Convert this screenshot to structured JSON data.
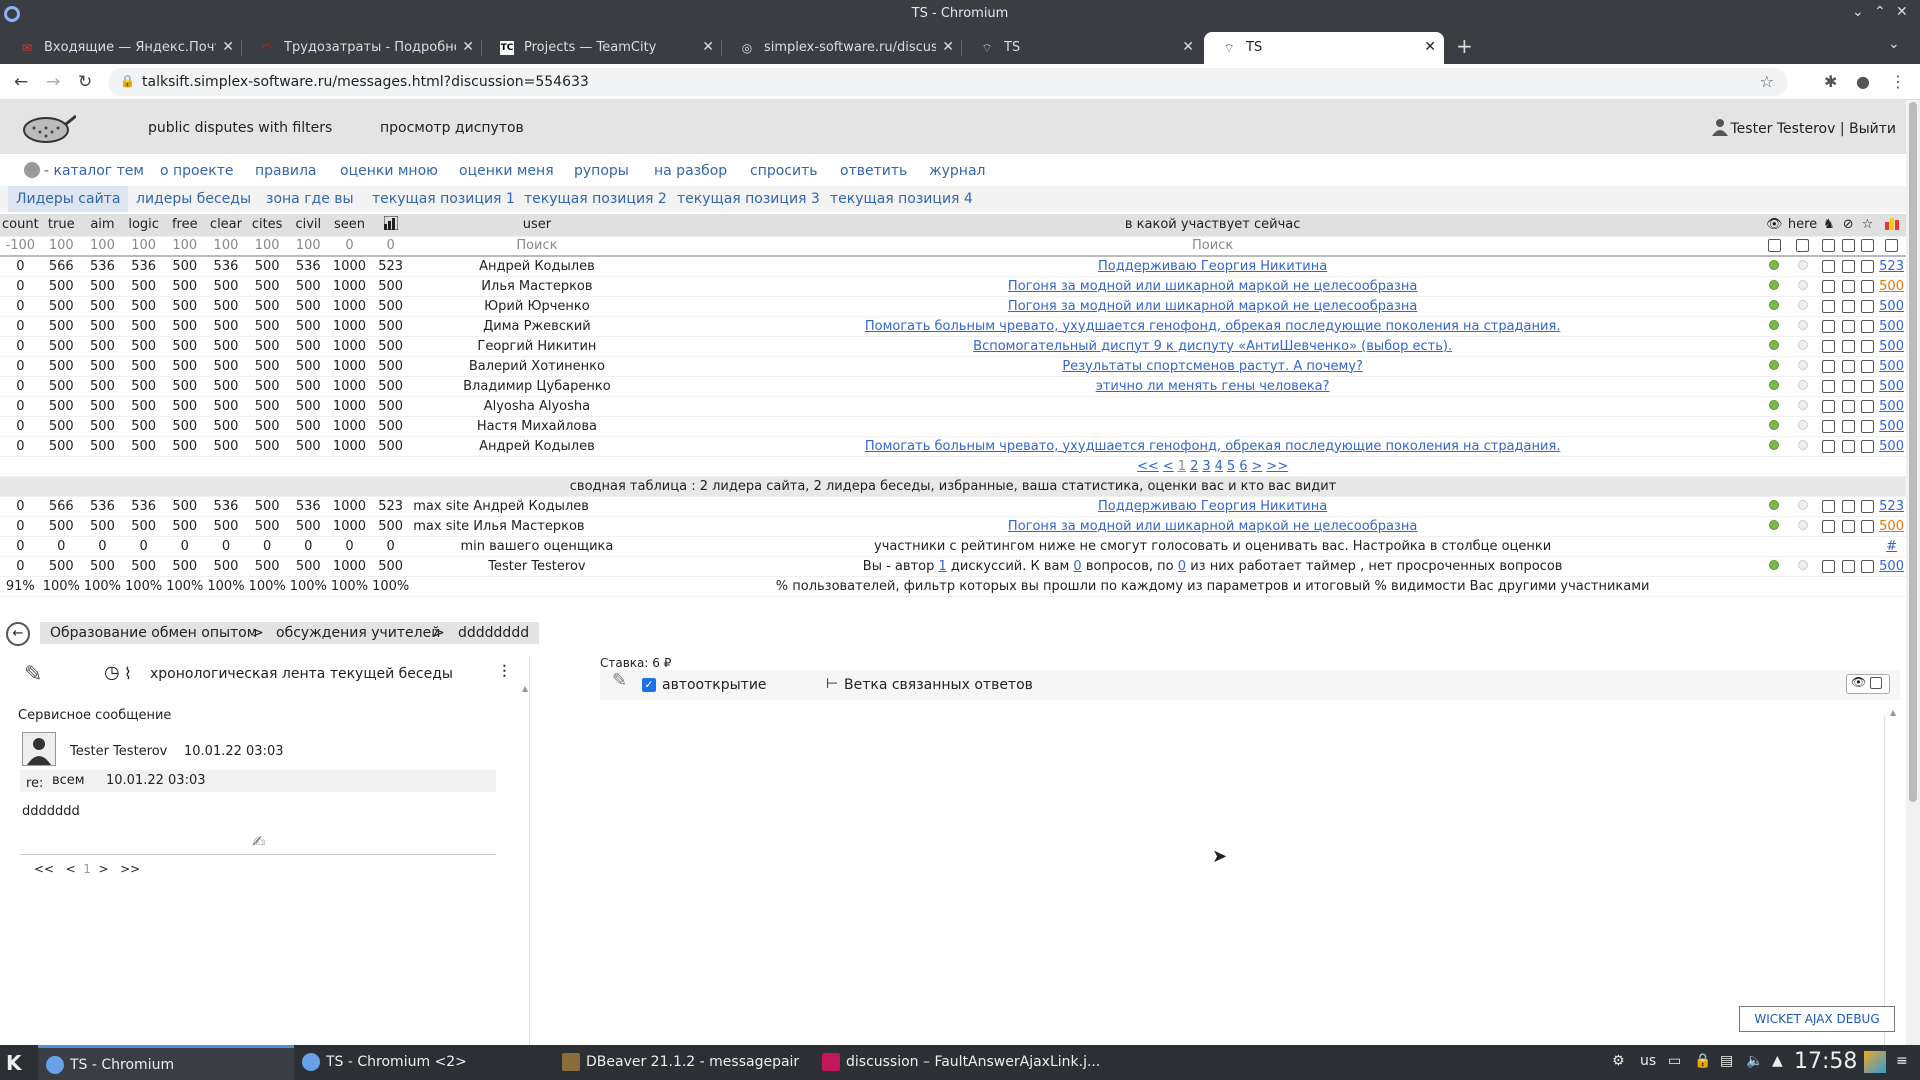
{
  "window": {
    "title": "TS - Chromium"
  },
  "tabs": [
    {
      "label": "Входящие — Яндекс.Почта",
      "icon": "mail-icon"
    },
    {
      "label": "Трудозатраты - Подробност",
      "icon": "redmine-icon"
    },
    {
      "label": "Projects — TeamCity",
      "icon": "teamcity-icon"
    },
    {
      "label": "simplex-software.ru/discussio",
      "icon": "globe-icon"
    },
    {
      "label": "TS",
      "icon": "site-icon"
    },
    {
      "label": "TS",
      "icon": "site-icon"
    }
  ],
  "address": {
    "url": "talksift.simplex-software.ru/messages.html?discussion=554633"
  },
  "site": {
    "title1": "public disputes with filters",
    "title2": "просмотр диспутов",
    "user": "Tester Testerov | Выйти"
  },
  "menu": [
    "- каталог тем",
    "о проекте",
    "правила",
    "оценки мною",
    "оценки меня",
    "рупоры",
    "на разбор",
    "спросить",
    "ответить",
    "журнал"
  ],
  "subtabs": [
    "Лидеры сайта",
    "лидеры беседы",
    "зона где вы",
    "текущая позиция 1",
    "текущая позиция 2",
    "текущая позиция 3",
    "текущая позиция 4"
  ],
  "table": {
    "headers": [
      "count",
      "true",
      "aim",
      "logic",
      "free",
      "clear",
      "cites",
      "civil",
      "seen",
      "",
      "user",
      "в какой участвует сейчас",
      "",
      "here",
      "",
      "",
      "",
      ""
    ],
    "search_placeholder": "Поиск",
    "filter_row": [
      "-100",
      "100",
      "100",
      "100",
      "100",
      "100",
      "100",
      "100",
      "0",
      "0"
    ],
    "rows": [
      {
        "n": [
          "0",
          "566",
          "536",
          "536",
          "500",
          "536",
          "500",
          "536",
          "1000",
          "523"
        ],
        "user": "Андрей Кодылев",
        "topic": "Поддерживаю Георгия Никитина",
        "score": "523",
        "orange": false
      },
      {
        "n": [
          "0",
          "500",
          "500",
          "500",
          "500",
          "500",
          "500",
          "500",
          "1000",
          "500"
        ],
        "user": "Илья Мастерков",
        "topic": "Погоня за модной или шикарной маркой не целесообразна",
        "score": "500",
        "orange": true
      },
      {
        "n": [
          "0",
          "500",
          "500",
          "500",
          "500",
          "500",
          "500",
          "500",
          "1000",
          "500"
        ],
        "user": "Юрий Юрченко",
        "topic": "Погоня за модной или шикарной маркой не целесообразна",
        "score": "500",
        "orange": false
      },
      {
        "n": [
          "0",
          "500",
          "500",
          "500",
          "500",
          "500",
          "500",
          "500",
          "1000",
          "500"
        ],
        "user": "Дима Ржевский",
        "topic": "Помогать больным чревато, ухудшается генофонд, обрекая последующие поколения на страдания.",
        "score": "500",
        "orange": false
      },
      {
        "n": [
          "0",
          "500",
          "500",
          "500",
          "500",
          "500",
          "500",
          "500",
          "1000",
          "500"
        ],
        "user": "Георгий Никитин",
        "topic": "Вспомогательный диспут 9 к диспуту «АнтиШевченко» (выбор есть).",
        "score": "500",
        "orange": false
      },
      {
        "n": [
          "0",
          "500",
          "500",
          "500",
          "500",
          "500",
          "500",
          "500",
          "1000",
          "500"
        ],
        "user": "Валерий Хотиненко",
        "topic": "Результаты спортсменов растут. А почему?",
        "score": "500",
        "orange": false
      },
      {
        "n": [
          "0",
          "500",
          "500",
          "500",
          "500",
          "500",
          "500",
          "500",
          "1000",
          "500"
        ],
        "user": "Владимир Цубаренко",
        "topic": "этично ли менять гены человека?",
        "score": "500",
        "orange": false
      },
      {
        "n": [
          "0",
          "500",
          "500",
          "500",
          "500",
          "500",
          "500",
          "500",
          "1000",
          "500"
        ],
        "user": "Alyosha Alyosha",
        "topic": "",
        "score": "500",
        "orange": false
      },
      {
        "n": [
          "0",
          "500",
          "500",
          "500",
          "500",
          "500",
          "500",
          "500",
          "1000",
          "500"
        ],
        "user": "Настя Михайлова",
        "topic": "",
        "score": "500",
        "orange": false
      },
      {
        "n": [
          "0",
          "500",
          "500",
          "500",
          "500",
          "500",
          "500",
          "500",
          "1000",
          "500"
        ],
        "user": "Андрей Кодылев",
        "topic": "Помогать больным чревато, ухудшается генофонд, обрекая последующие поколения на страдания.",
        "score": "500",
        "orange": false
      }
    ],
    "pager": [
      "<<",
      "<",
      "1",
      "2",
      "3",
      "4",
      "5",
      "6",
      ">",
      ">>"
    ],
    "summary_caption": "сводная таблица : 2 лидера сайта, 2 лидера беседы, избранные, ваша статистика, оценки вас и кто вас видит",
    "summary_rows": [
      {
        "n": [
          "0",
          "566",
          "536",
          "536",
          "500",
          "536",
          "500",
          "536",
          "1000",
          "523"
        ],
        "user": "max site Андрей Кодылев",
        "topic": "Поддерживаю Георгия Никитина",
        "score": "523",
        "orange": false
      },
      {
        "n": [
          "0",
          "500",
          "500",
          "500",
          "500",
          "500",
          "500",
          "500",
          "1000",
          "500"
        ],
        "user": "max site Илья Мастерков",
        "topic": "Погоня за модной или шикарной маркой не целесообразна",
        "score": "500",
        "orange": true
      }
    ],
    "min_row": {
      "n": [
        "0",
        "0",
        "0",
        "0",
        "0",
        "0",
        "0",
        "0",
        "0",
        "0"
      ],
      "user": "min вашего оценщика",
      "text": "участники с рейтингом ниже не смогут голосовать и оценивать вас. Настройка в столбце оценки",
      "score": "#"
    },
    "me_row": {
      "n": [
        "0",
        "500",
        "500",
        "500",
        "500",
        "500",
        "500",
        "500",
        "1000",
        "500"
      ],
      "user": "Tester Testerov",
      "t1": "Вы - автор ",
      "a1": "1",
      "t2": " дискуссий. К вам ",
      "a2": "0",
      "t3": " вопросов, по ",
      "a3": "0",
      "t4": " из них работает таймер , нет просроченных вопросов",
      "score": "500"
    },
    "pct_row": {
      "n": [
        "91%",
        "100%",
        "100%",
        "100%",
        "100%",
        "100%",
        "100%",
        "100%",
        "100%",
        "100%"
      ],
      "text": "% пользователей, фильтр которых вы прошли по каждому из параметров и итоговый % видимости Вас другими участниками"
    }
  },
  "breadcrumbs": [
    "Образование обмен опытом",
    "обсуждения учителей",
    "dddddddd"
  ],
  "left_panel": {
    "feed_title": "хронологическая лента текущей беседы",
    "service": "Сервисное сообщение",
    "author": "Tester Testerov",
    "date": "10.01.22 03:03",
    "re_label": "re:",
    "re_to": "всем",
    "re_date": "10.01.22 03:03",
    "body": "ddddddd",
    "pager": [
      "<<",
      "<",
      "1",
      ">",
      ">>"
    ]
  },
  "right_panel": {
    "stake": "Ставка: 6 ₽",
    "autoopen": "автооткрытие",
    "branch": "Ветка связанных ответов",
    "debug": "WICKET AJAX DEBUG"
  },
  "taskbar": {
    "items": [
      "TS - Chromium",
      "TS - Chromium <2>",
      "DBeaver 21.1.2 - messagepair",
      "discussion – FaultAnswerAjaxLink.j..."
    ],
    "lang": "us",
    "time": "17:58"
  }
}
